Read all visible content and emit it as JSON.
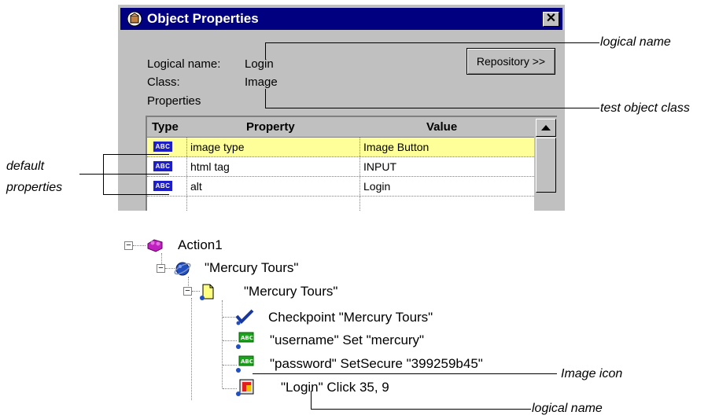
{
  "dialog": {
    "title": "Object Properties",
    "close_glyph": "✕",
    "logical_name_label": "Logical name:",
    "logical_name_value": "Login",
    "class_label": "Class:",
    "class_value": "Image",
    "properties_label": "Properties",
    "repository_button": "Repository >>",
    "grid": {
      "headers": [
        "Type",
        "Property",
        "Value"
      ],
      "rows": [
        {
          "type_badge": "ABC",
          "property": "image type",
          "value": "Image Button",
          "selected": true
        },
        {
          "type_badge": "ABC",
          "property": "html tag",
          "value": "INPUT",
          "selected": false
        },
        {
          "type_badge": "ABC",
          "property": "alt",
          "value": "Login",
          "selected": false
        }
      ]
    }
  },
  "callouts": {
    "logical_name_top": "logical name",
    "test_object_class": "test object class",
    "default_properties_line1": "default",
    "default_properties_line2": "properties",
    "image_icon": "Image icon",
    "logical_name_bottom": "logical name"
  },
  "tree": {
    "nodes": [
      {
        "label": "Action1",
        "icon": "action-icon"
      },
      {
        "label": "\"Mercury Tours\"",
        "icon": "browser-icon"
      },
      {
        "label": "\"Mercury Tours\"",
        "icon": "page-icon"
      },
      {
        "label": "Checkpoint \"Mercury Tours\"",
        "icon": "checkpoint-icon"
      },
      {
        "label": "\"username\" Set \"mercury\"",
        "icon": "edit-field-icon"
      },
      {
        "label": "\"password\" SetSecure \"399259b45\"",
        "icon": "edit-field-icon"
      },
      {
        "label": "\"Login\" Click 35, 9",
        "icon": "image-icon"
      }
    ],
    "expander_glyph": "−"
  },
  "colors": {
    "titlebar": "#000080",
    "dialog_bg": "#c0c0c0",
    "selected_row": "#ffff99",
    "abc_badge": "#1e1ec8"
  }
}
